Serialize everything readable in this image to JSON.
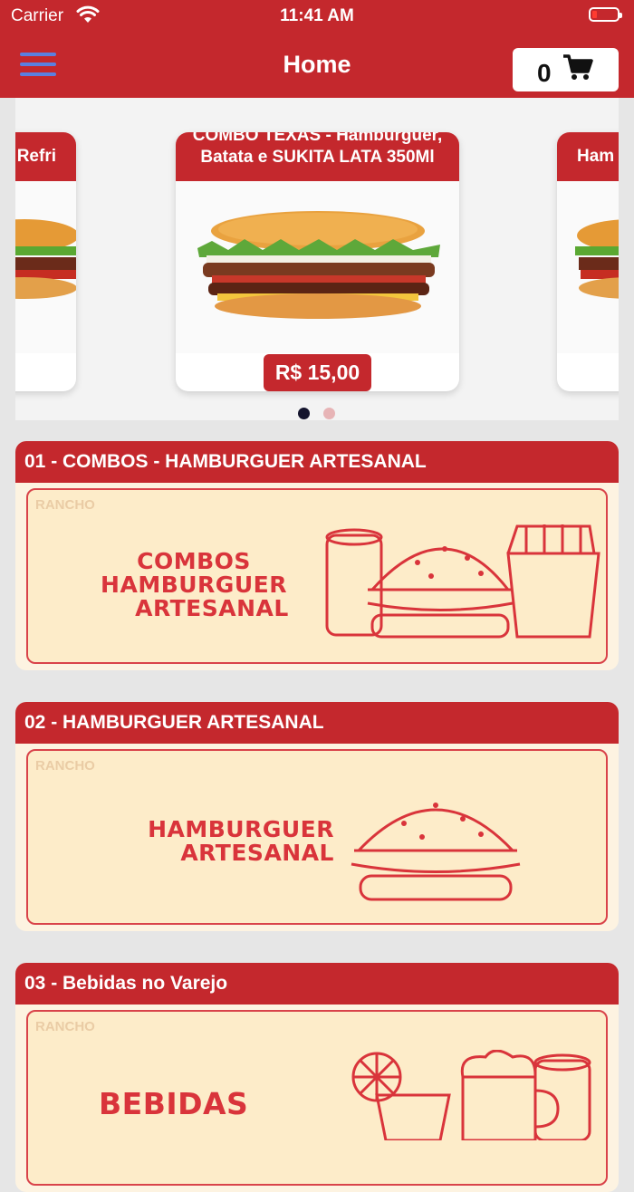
{
  "status_bar": {
    "carrier": "Carrier",
    "time": "11:41 AM"
  },
  "header": {
    "title": "Home",
    "cart_count": "0"
  },
  "carousel": {
    "left_card_title": "Refri",
    "main_card_title": "COMBO TEXAS - Hambúrguer, Batata e SUKITA LATA 350Ml",
    "main_card_price": "R$ 15,00",
    "right_card_title": "Ham",
    "page_count": 2,
    "active_page": 1
  },
  "categories": [
    {
      "title": "01 - COMBOS - HAMBURGUER ARTESANAL",
      "banner_lines": [
        "COMBOS",
        "HAMBURGUER",
        "ARTESANAL"
      ]
    },
    {
      "title": "02 - HAMBURGUER ARTESANAL",
      "banner_lines": [
        "HAMBURGUER",
        "ARTESANAL"
      ]
    },
    {
      "title": "03 - Bebidas no Varejo",
      "banner_lines": [
        "BEBIDAS"
      ]
    }
  ],
  "logo_text": "RANCHO",
  "colors": {
    "brand_red": "#c4282d",
    "menu_blue": "#5b7fe0",
    "banner_bg": "#fdecc9"
  },
  "icons": [
    "menu-icon",
    "cart-icon",
    "wifi-icon",
    "battery-icon"
  ]
}
